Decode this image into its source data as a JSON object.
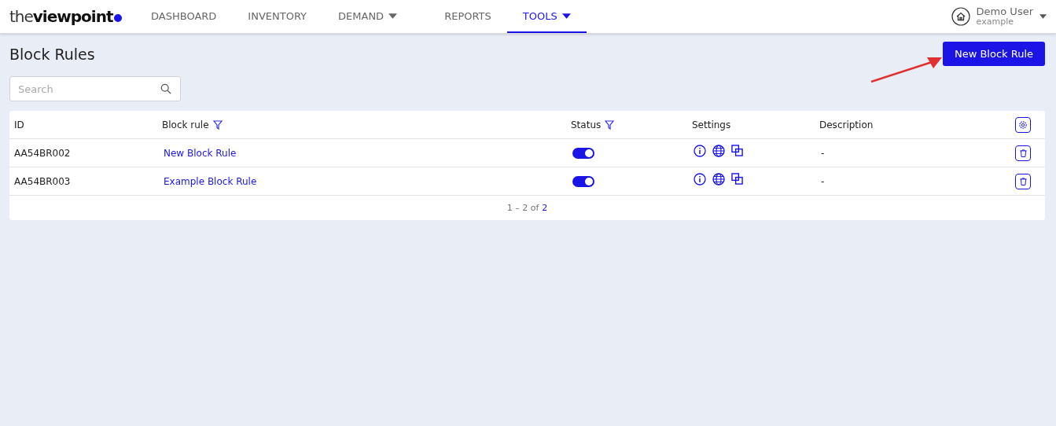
{
  "logo": {
    "light": "the",
    "bold": "viewpoint"
  },
  "nav": [
    {
      "label": "DASHBOARD",
      "dropdown": false,
      "selected": false
    },
    {
      "label": "INVENTORY",
      "dropdown": false,
      "selected": false
    },
    {
      "label": "DEMAND",
      "dropdown": true,
      "selected": false
    },
    {
      "label": "REPORTS",
      "dropdown": false,
      "selected": false
    },
    {
      "label": "TOOLS",
      "dropdown": true,
      "selected": true
    }
  ],
  "user": {
    "name": "Demo User",
    "account": "example"
  },
  "page_title": "Block Rules",
  "new_button": "New Block Rule",
  "search": {
    "placeholder": "Search"
  },
  "table": {
    "columns": [
      {
        "label": "ID",
        "filter": false
      },
      {
        "label": "Block rule",
        "filter": true
      },
      {
        "label": "Status",
        "filter": true
      },
      {
        "label": "Settings",
        "filter": false
      },
      {
        "label": "Description",
        "filter": false
      }
    ],
    "rows": [
      {
        "id": "AA54BR002",
        "rule": "New Block Rule",
        "on": true,
        "description": "-"
      },
      {
        "id": "AA54BR003",
        "rule": "Example Block Rule",
        "on": true,
        "description": "-"
      }
    ]
  },
  "pagination": {
    "range": "1 – 2 of",
    "total": "2"
  }
}
